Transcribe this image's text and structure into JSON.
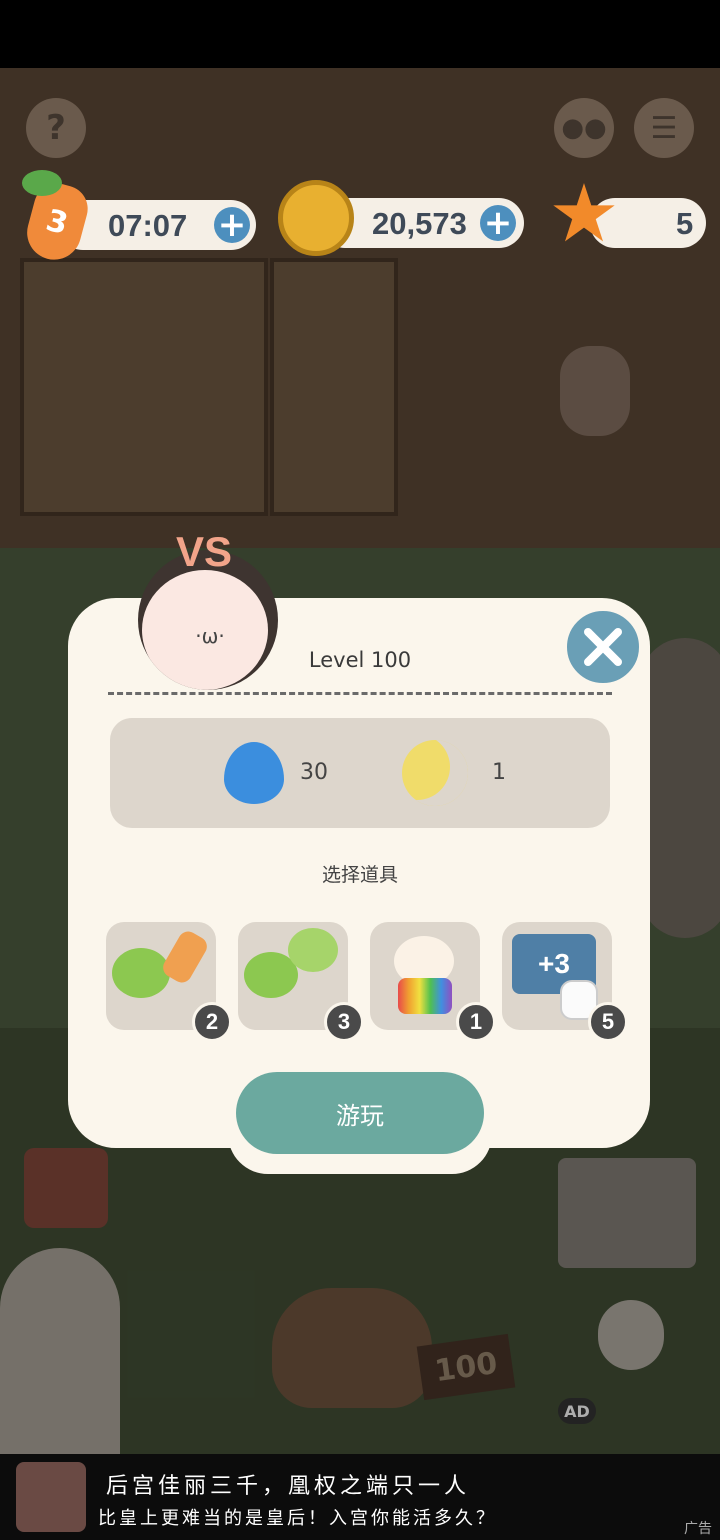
{
  "hud": {
    "lives_count": "3",
    "timer": "07:07",
    "coins": "20,573",
    "stars": "5",
    "help_icon": "question-icon",
    "chat_icon": "chat-icon",
    "menu_icon": "menu-icon"
  },
  "dialog": {
    "vs_label": "VS",
    "level_title": "Level 100",
    "rewards": [
      {
        "icon": "water-drop-icon",
        "value": "30"
      },
      {
        "icon": "moon-icon",
        "value": "1"
      }
    ],
    "select_items_label": "选择道具",
    "items": [
      {
        "icon": "cabbage-carrot-booster-icon",
        "count": "2"
      },
      {
        "icon": "double-cabbage-booster-icon",
        "count": "3"
      },
      {
        "icon": "rainbow-bunny-booster-icon",
        "count": "1"
      },
      {
        "icon": "plus-moves-booster-icon",
        "label": "+3",
        "count": "5"
      }
    ],
    "play_label": "游玩",
    "close_icon": "close-icon"
  },
  "scene": {
    "basket_price": "100",
    "ad_chip": "AD"
  },
  "ad_banner": {
    "line1": "后宫佳丽三千，凰权之端只一人",
    "line2": "比皇上更难当的是皇后！入宫你能活多久？",
    "ad_label": "广告"
  },
  "colors": {
    "accent_blue": "#4d8fbe",
    "play_green": "#6ba99f",
    "dialog_bg": "#fbf6ec",
    "close_blue": "#6a9fb6"
  }
}
